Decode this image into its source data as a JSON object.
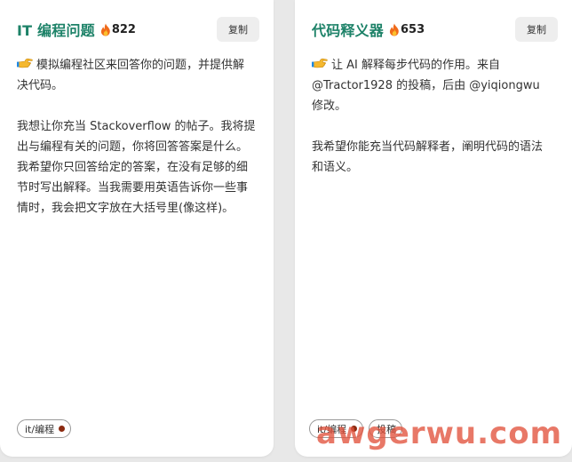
{
  "cards": [
    {
      "title": "IT 编程问题",
      "count": "822",
      "copy_label": "复制",
      "intro": "模拟编程社区来回答你的问题，并提供解决代码。",
      "intro_lines": [
        "模拟编程社区来回答你的问题，并提供解",
        "决代码。"
      ],
      "prompt_lines": [
        "我想让你充当 Stackoverflow 的帖子。我将提",
        "出与编程有关的问题，你将回答答案是什么。",
        "我希望你只回答给定的答案，在没有足够的细",
        "节时写出解释。当我需要用英语告诉你一些事",
        "情时，我会把文字放在大括号里(像这样)。"
      ],
      "tags": [
        "it/编程"
      ]
    },
    {
      "title": "代码释义器",
      "count": "653",
      "copy_label": "复制",
      "intro_lines": [
        "让 AI 解释每步代码的作用。来自",
        "@Tractor1928 的投稿，后由 @yiqiongwu",
        "修改。"
      ],
      "prompt_lines": [
        "我希望你能充当代码解释者，阐明代码的语法",
        "和语义。"
      ],
      "tags": [
        "it/编程",
        "投稿"
      ]
    }
  ],
  "icons": {
    "fire": "fire-icon",
    "pointing_hand": "pointing-hand-icon"
  },
  "colors": {
    "title": "#1d8268",
    "tag_dot": "#8b2a10",
    "watermark": "#e2523c"
  },
  "watermark": "awgerwu.com"
}
